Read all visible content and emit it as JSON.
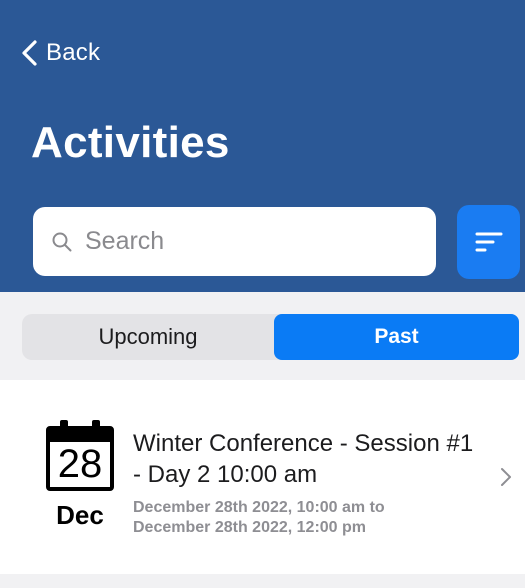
{
  "header": {
    "back_label": "Back",
    "title": "Activities",
    "bg_color": "#2b5896"
  },
  "search": {
    "placeholder": "Search",
    "value": ""
  },
  "filter": {
    "icon": "filter-lines-icon",
    "color": "#1a7cf2"
  },
  "tabs": {
    "items": [
      {
        "label": "Upcoming",
        "selected": false
      },
      {
        "label": "Past",
        "selected": true
      }
    ],
    "active_color": "#0a7bf5"
  },
  "activities": [
    {
      "calendar_day": "28",
      "calendar_month": "Dec",
      "title": "Winter Conference - Session #1 - Day 2 10:00 am",
      "date_range": "December 28th 2022, 10:00 am to December 28th 2022, 12:00 pm"
    }
  ]
}
